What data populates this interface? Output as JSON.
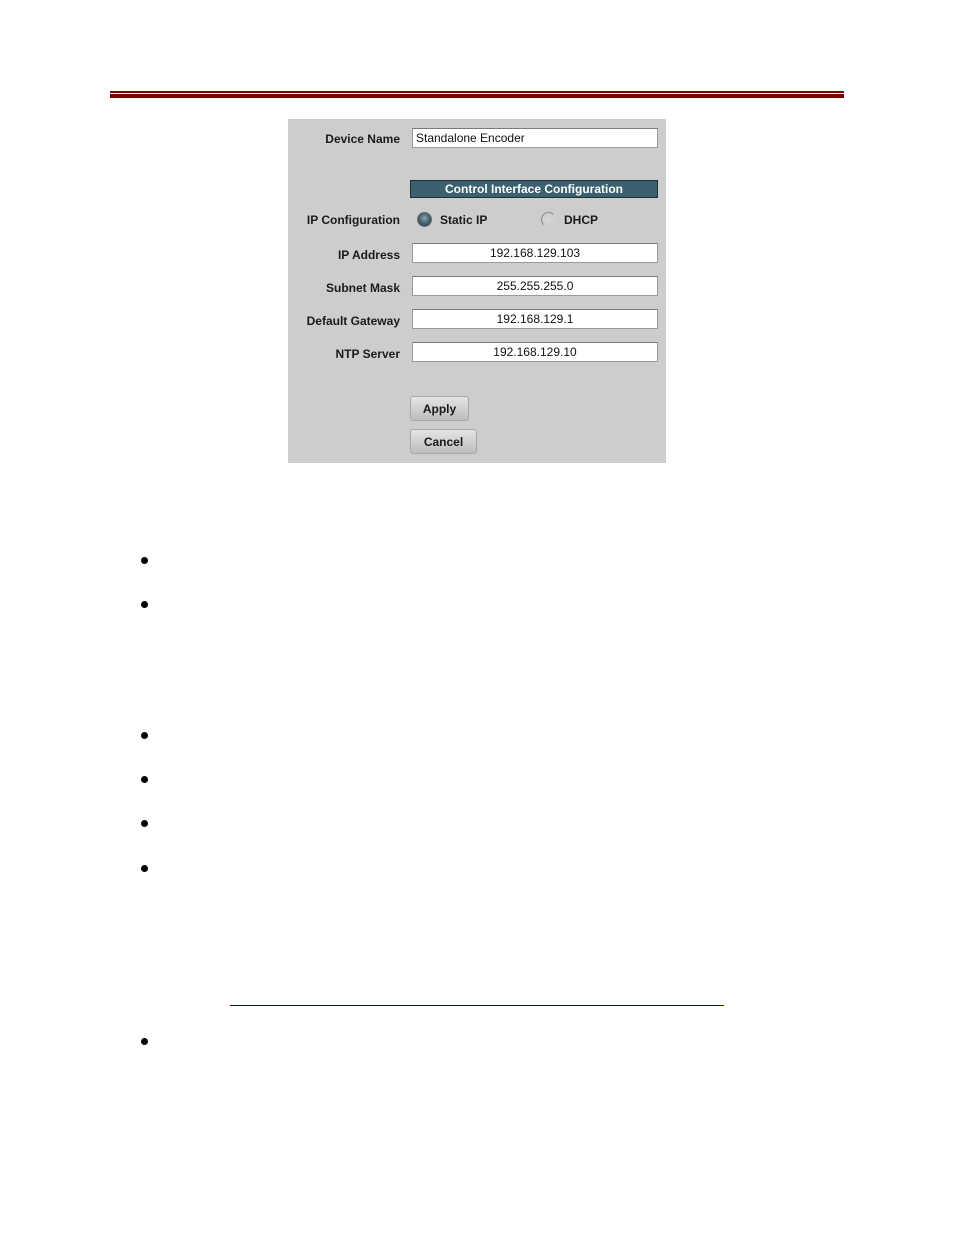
{
  "header": {
    "rule_color": "#7f0000"
  },
  "panel": {
    "device_name": {
      "label": "Device Name",
      "value": "Standalone Encoder"
    },
    "section_title": "Control Interface Configuration",
    "ip_configuration": {
      "label": "IP Configuration",
      "options": [
        {
          "label": "Static IP",
          "selected": true
        },
        {
          "label": "DHCP",
          "selected": false
        }
      ]
    },
    "fields": [
      {
        "label": "IP Address",
        "value": "192.168.129.103"
      },
      {
        "label": "Subnet Mask",
        "value": "255.255.255.0"
      },
      {
        "label": "Default Gateway",
        "value": "192.168.129.1"
      },
      {
        "label": "NTP Server",
        "value": "192.168.129.10"
      }
    ],
    "buttons": {
      "apply": "Apply",
      "cancel": "Cancel"
    },
    "colors": {
      "background": "#cdcdcd",
      "section_band": "#3b6170"
    }
  },
  "document": {
    "bullet_count_group1": 2,
    "bullet_count_group2": 4,
    "bullet_count_group3": 1,
    "link_color": "#0000cc"
  }
}
